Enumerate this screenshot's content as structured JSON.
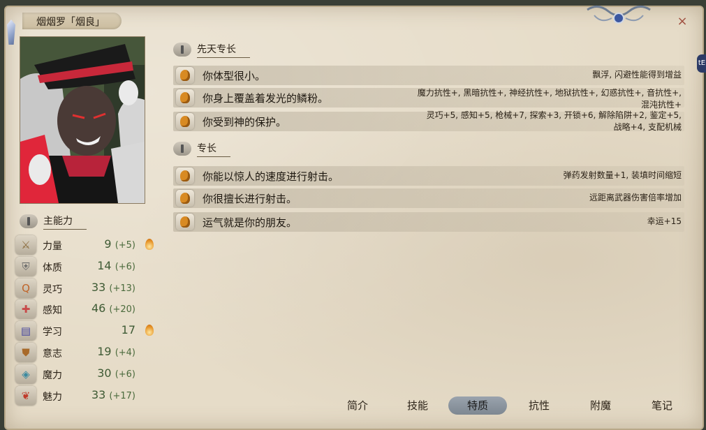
{
  "window": {
    "title": "烟烟罗「烟良」",
    "close_label": "×",
    "side_badge": "tE"
  },
  "innate_section": {
    "title": "先天专长",
    "traits": [
      {
        "text": "你体型很小。",
        "effect_lines": [
          "飘浮, 闪避性能得到增益"
        ]
      },
      {
        "text": "你身上覆盖着发光的鳞粉。",
        "effect_lines": [
          "魔力抗性+, 黑暗抗性+, 神经抗性+, 地狱抗性+, 幻惑抗性+, 音抗性+,",
          "混沌抗性+"
        ]
      },
      {
        "text": "你受到神的保护。",
        "effect_lines": [
          "灵巧+5, 感知+5, 枪械+7, 探索+3, 开锁+6, 解除陷阱+2, 鉴定+5,",
          "战略+4, 支配机械"
        ]
      }
    ]
  },
  "feat_section": {
    "title": "专长",
    "traits": [
      {
        "text": "你能以惊人的速度进行射击。",
        "effect_lines": [
          "弹药发射数量+1, 装填时间缩短"
        ]
      },
      {
        "text": "你很擅长进行射击。",
        "effect_lines": [
          "远距离武器伤害倍率增加"
        ]
      },
      {
        "text": "运气就是你的朋友。",
        "effect_lines": [
          "幸运+15"
        ]
      }
    ]
  },
  "attributes_section": {
    "title": "主能力",
    "items": [
      {
        "name": "力量",
        "value": "9",
        "bonus": "(+5)",
        "icon": "sword-icon",
        "glyph": "⚔",
        "flame": true
      },
      {
        "name": "体质",
        "value": "14",
        "bonus": "(+6)",
        "icon": "armor-icon",
        "glyph": "⛨",
        "flame": false
      },
      {
        "name": "灵巧",
        "value": "33",
        "bonus": "(+13)",
        "icon": "dexterity-icon",
        "glyph": "Q",
        "flame": false
      },
      {
        "name": "感知",
        "value": "46",
        "bonus": "(+20)",
        "icon": "perception-icon",
        "glyph": "✚",
        "flame": false
      },
      {
        "name": "学习",
        "value": "17",
        "bonus": "",
        "icon": "book-icon",
        "glyph": "▤",
        "flame": true
      },
      {
        "name": "意志",
        "value": "19",
        "bonus": "(+4)",
        "icon": "shield-icon",
        "glyph": "⛊",
        "flame": false
      },
      {
        "name": "魔力",
        "value": "30",
        "bonus": "(+6)",
        "icon": "magic-icon",
        "glyph": "◈",
        "flame": false
      },
      {
        "name": "魅力",
        "value": "33",
        "bonus": "(+17)",
        "icon": "ribbon-icon",
        "glyph": "❦",
        "flame": false
      }
    ]
  },
  "tabs": [
    {
      "label": "简介",
      "active": false
    },
    {
      "label": "技能",
      "active": false
    },
    {
      "label": "特质",
      "active": true
    },
    {
      "label": "抗性",
      "active": false
    },
    {
      "label": "附魔",
      "active": false
    },
    {
      "label": "笔记",
      "active": false
    }
  ]
}
